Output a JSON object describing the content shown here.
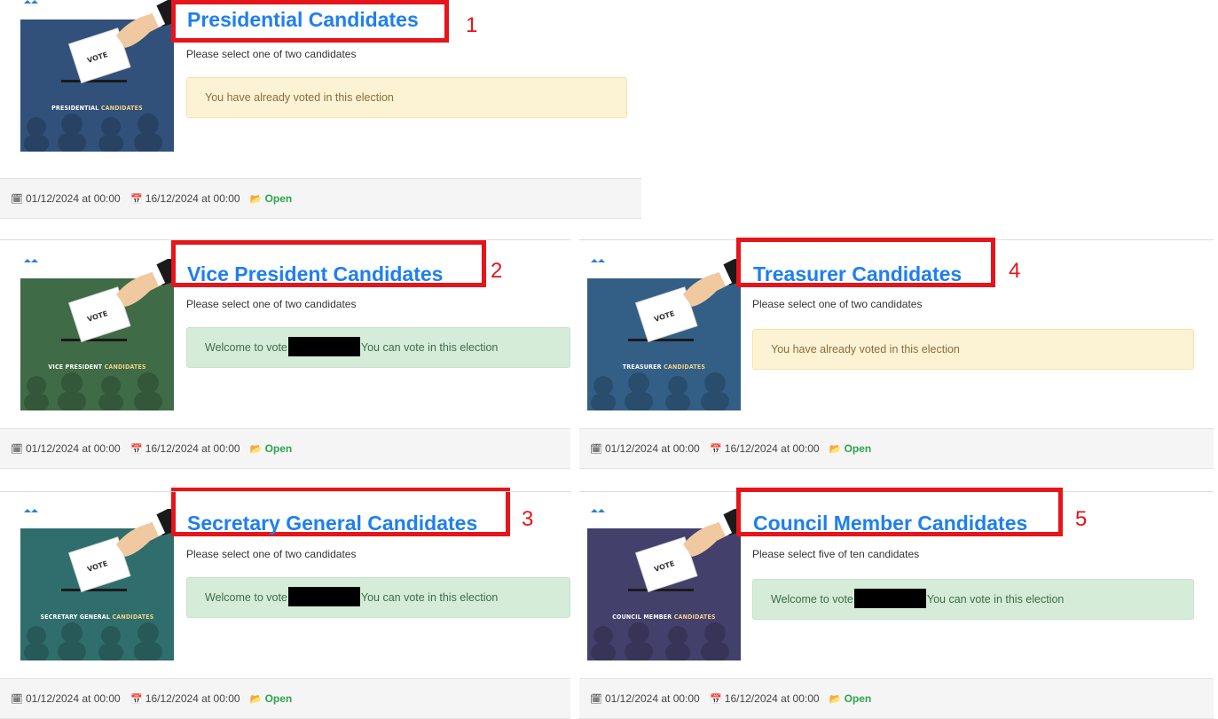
{
  "cards": [
    {
      "title": "Presidential Candidates",
      "number": "1",
      "subtitle": "Please select one of two candidates",
      "alert_type": "warn",
      "alert_text": "You have already voted in this election",
      "thumb_label_white": "PRESIDENTIAL",
      "thumb_label_accent": "CANDIDATES",
      "thumb_color": "#31517b",
      "start": "01/12/2024 at 00:00",
      "end": "16/12/2024 at 00:00",
      "status": "Open"
    },
    {
      "title": "Vice President Candidates",
      "number": "2",
      "subtitle": "Please select one of two candidates",
      "alert_type": "ok",
      "alert_prefix": "Welcome to vote",
      "alert_suffix": "You can vote in this election",
      "thumb_label_white": "VICE PRESIDENT",
      "thumb_label_accent": "CANDIDATES",
      "thumb_color": "#3f6b46",
      "start": "01/12/2024 at 00:00",
      "end": "16/12/2024 at 00:00",
      "status": "Open"
    },
    {
      "title": "Secretary General Candidates",
      "number": "3",
      "subtitle": "Please select one of two candidates",
      "alert_type": "ok",
      "alert_prefix": "Welcome to vote",
      "alert_suffix": "You can vote in this election",
      "thumb_label_white": "SECRETARY GENERAL",
      "thumb_label_accent": "CANDIDATES",
      "thumb_color": "#2f6e6c",
      "start": "01/12/2024 at 00:00",
      "end": "16/12/2024 at 00:00",
      "status": "Open"
    },
    {
      "title": "Treasurer Candidates",
      "number": "4",
      "subtitle": "Please select one of two candidates",
      "alert_type": "warn",
      "alert_text": "You have already voted in this election",
      "thumb_label_white": "TREASURER",
      "thumb_label_accent": "CANDIDATES",
      "thumb_color": "#335f86",
      "start": "01/12/2024 at 00:00",
      "end": "16/12/2024 at 00:00",
      "status": "Open"
    },
    {
      "title": "Council Member Candidates",
      "number": "5",
      "subtitle": "Please select five of ten candidates",
      "alert_type": "ok",
      "alert_prefix": "Welcome to vote",
      "alert_suffix": "You can vote in this election",
      "thumb_label_white": "COUNCIL MEMBER",
      "thumb_label_accent": "CANDIDATES",
      "thumb_color": "#44406c",
      "start": "01/12/2024 at 00:00",
      "end": "16/12/2024 at 00:00",
      "status": "Open"
    }
  ],
  "ballot_text": "VOTE",
  "icons": {
    "start": "calendar-icon",
    "end": "calendar-end-icon",
    "status": "folder-open-icon"
  },
  "colors": {
    "title": "#1e7ff0",
    "annotation": "#e6141b",
    "status": "#2ea44f"
  }
}
